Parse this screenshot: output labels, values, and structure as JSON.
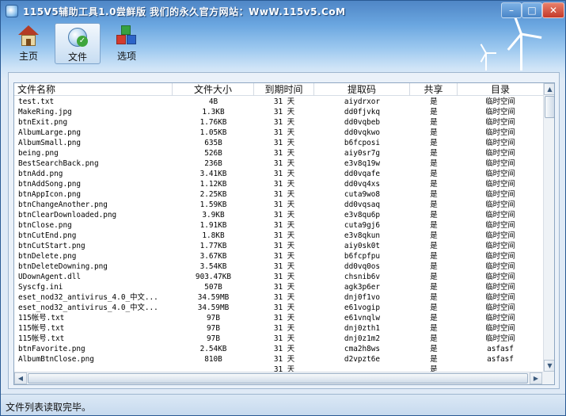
{
  "window": {
    "title": "115V5辅助工具1.0尝鲜版 我们的永久官方网站：WwW.115v5.CoM",
    "controls": {
      "minimize": "–",
      "maximize": "□",
      "close": "✕"
    }
  },
  "toolbar": {
    "items": [
      {
        "label": "主页",
        "icon": "house-icon"
      },
      {
        "label": "文件",
        "icon": "file-search-icon",
        "active": true
      },
      {
        "label": "选项",
        "icon": "cubes-icon"
      }
    ]
  },
  "table": {
    "columns": [
      "文件名称",
      "文件大小",
      "到期时间",
      "提取码",
      "共享",
      "目录"
    ],
    "rows": [
      [
        "test.txt",
        "4B",
        "31 天",
        "aiydrxor",
        "是",
        "临时空间"
      ],
      [
        "MakeRing.jpg",
        "1.3KB",
        "31 天",
        "dd0fjvkq",
        "是",
        "临时空间"
      ],
      [
        "btnExit.png",
        "1.76KB",
        "31 天",
        "dd0vqbeb",
        "是",
        "临时空间"
      ],
      [
        "AlbumLarge.png",
        "1.05KB",
        "31 天",
        "dd0vqkwo",
        "是",
        "临时空间"
      ],
      [
        "AlbumSmall.png",
        "635B",
        "31 天",
        "b6fcposi",
        "是",
        "临时空间"
      ],
      [
        "being.png",
        "526B",
        "31 天",
        "aiy0sr7g",
        "是",
        "临时空间"
      ],
      [
        "BestSearchBack.png",
        "236B",
        "31 天",
        "e3v8q19w",
        "是",
        "临时空间"
      ],
      [
        "btnAdd.png",
        "3.41KB",
        "31 天",
        "dd0vqafe",
        "是",
        "临时空间"
      ],
      [
        "btnAddSong.png",
        "1.12KB",
        "31 天",
        "dd0vq4xs",
        "是",
        "临时空间"
      ],
      [
        "btnAppIcon.png",
        "2.25KB",
        "31 天",
        "cuta9wo8",
        "是",
        "临时空间"
      ],
      [
        "btnChangeAnother.png",
        "1.59KB",
        "31 天",
        "dd0vqsaq",
        "是",
        "临时空间"
      ],
      [
        "btnClearDownloaded.png",
        "3.9KB",
        "31 天",
        "e3v8qu6p",
        "是",
        "临时空间"
      ],
      [
        "btnClose.png",
        "1.91KB",
        "31 天",
        "cuta9gj6",
        "是",
        "临时空间"
      ],
      [
        "btnCutEnd.png",
        "1.8KB",
        "31 天",
        "e3v8qkun",
        "是",
        "临时空间"
      ],
      [
        "btnCutStart.png",
        "1.77KB",
        "31 天",
        "aiy0sk0t",
        "是",
        "临时空间"
      ],
      [
        "btnDelete.png",
        "3.67KB",
        "31 天",
        "b6fcpfpu",
        "是",
        "临时空间"
      ],
      [
        "btnDeleteDowning.png",
        "3.54KB",
        "31 天",
        "dd0vq0os",
        "是",
        "临时空间"
      ],
      [
        "UDownAgent.dll",
        "903.47KB",
        "31 天",
        "chsnib6v",
        "是",
        "临时空间"
      ],
      [
        "Syscfg.ini",
        "507B",
        "31 天",
        "agk3p6er",
        "是",
        "临时空间"
      ],
      [
        "eset_nod32_antivirus_4.0_中文...",
        "34.59MB",
        "31 天",
        "dnj0f1vo",
        "是",
        "临时空间"
      ],
      [
        "eset_nod32_antivirus_4.0_中文...",
        "34.59MB",
        "31 天",
        "e61vogip",
        "是",
        "临时空间"
      ],
      [
        "115帐号.txt",
        "97B",
        "31 天",
        "e61vnqlw",
        "是",
        "临时空间"
      ],
      [
        "115帐号.txt",
        "97B",
        "31 天",
        "dnj0zth1",
        "是",
        "临时空间"
      ],
      [
        "115帐号.txt",
        "97B",
        "31 天",
        "dnj0z1m2",
        "是",
        "临时空间"
      ],
      [
        "btnFavorite.png",
        "2.54KB",
        "31 天",
        "cma2h8ws",
        "是",
        "asfasf"
      ],
      [
        "AlbumBtnClose.png",
        "810B",
        "31 天",
        "d2vpzt6e",
        "是",
        "asfasf"
      ],
      [
        "",
        "",
        "31 天",
        "",
        "是",
        ""
      ]
    ]
  },
  "scrollbars": {
    "up": "▲",
    "down": "▼",
    "left": "◀",
    "right": "▶"
  },
  "status": {
    "text": "文件列表读取完毕。"
  }
}
